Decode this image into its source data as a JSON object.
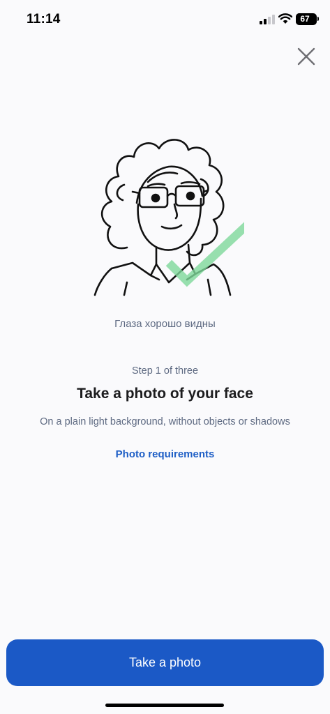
{
  "status_bar": {
    "time": "11:14",
    "battery_percent": "67",
    "battery_level": 0.67
  },
  "icons": {
    "close": "close-icon",
    "signal": "cellular-signal-icon",
    "wifi": "wifi-icon",
    "battery": "battery-icon",
    "illustration": "face-with-glasses-illustration",
    "check": "checkmark-icon"
  },
  "colors": {
    "primary": "#1b59c6",
    "link": "#1f5fc6",
    "check_green": "#7ed89a",
    "secondary_text": "#5e6a82",
    "background": "#fafafc"
  },
  "illustration": {
    "caption": "Глаза хорошо видны"
  },
  "content": {
    "step": "Step 1 of three",
    "title": "Take a photo of your face",
    "subtitle": "On a plain light background, without objects or shadows",
    "requirements_link": "Photo requirements"
  },
  "actions": {
    "take_photo": "Take a photo"
  }
}
